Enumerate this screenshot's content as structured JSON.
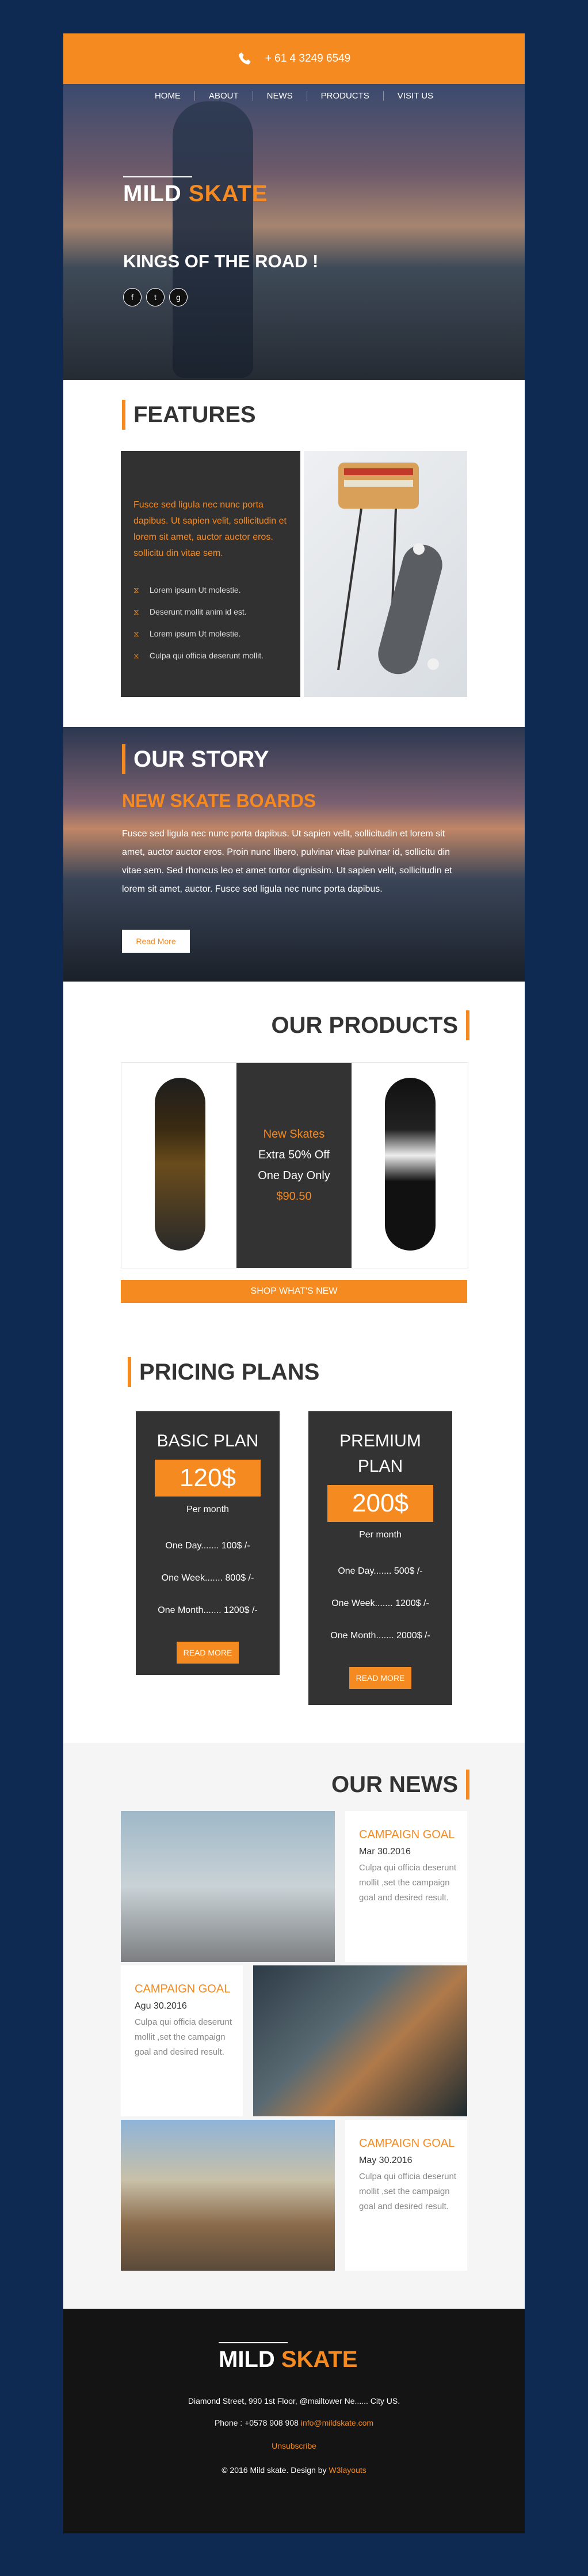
{
  "topbar": {
    "phone": "+ 61 4 3249 6549",
    "phone_icon": "phone-icon"
  },
  "nav": [
    "HOME",
    "ABOUT",
    "NEWS",
    "PRODUCTS",
    "VISIT US"
  ],
  "hero": {
    "logo_mild": "MILD",
    "logo_skate": "SKATE",
    "tagline": "KINGS OF THE ROAD !",
    "social": [
      "f",
      "t",
      "g"
    ]
  },
  "features": {
    "title": "FEATURES",
    "text": "Fusce sed ligula nec nunc porta dapibus. Ut sapien velit, sollicitudin et lorem sit amet, auctor auctor eros. sollicitu din vitae sem.",
    "items": [
      "Lorem ipsum Ut molestie.",
      "Deserunt mollit anim id est.",
      "Lorem ipsum Ut molestie.",
      "Culpa qui officia deserunt mollit."
    ]
  },
  "story": {
    "title": "OUR STORY",
    "subtitle": "NEW SKATE BOARDS",
    "text": "Fusce sed ligula nec nunc porta dapibus. Ut sapien velit, sollicitudin et lorem sit amet, auctor auctor eros. Proin nunc libero, pulvinar vitae pulvinar id, sollicitu din vitae sem. Sed rhoncus leo et amet tortor dignissim. Ut sapien velit, sollicitudin et lorem sit amet, auctor. Fusce sed ligula nec nunc porta dapibus.",
    "button": "Read More"
  },
  "products": {
    "title": "OUR PRODUCTS",
    "promo": [
      "New Skates",
      "Extra 50% Off",
      "One Day Only",
      "$90.50"
    ],
    "button": "SHOP WHAT'S NEW"
  },
  "pricing": {
    "title": "PRICING PLANS",
    "plans": [
      {
        "name": "BASIC PLAN",
        "price": "120$",
        "per": "Per month",
        "rows": [
          "One Day....... 100$ /-",
          "One Week....... 800$ /-",
          "One Month....... 1200$ /-"
        ],
        "button": "READ MORE"
      },
      {
        "name": "PREMIUM PLAN",
        "price": "200$",
        "per": "Per month",
        "rows": [
          "One Day....... 500$ /-",
          "One Week....... 1200$ /-",
          "One Month....... 2000$ /-"
        ],
        "button": "READ MORE"
      }
    ]
  },
  "news": {
    "title": "OUR NEWS",
    "items": [
      {
        "title": "CAMPAIGN GOAL",
        "date": "Mar 30.2016",
        "desc": "Culpa qui officia deserunt mollit ,set the campaign goal and desired result."
      },
      {
        "title": "CAMPAIGN GOAL",
        "date": "Agu 30.2016",
        "desc": "Culpa qui officia deserunt mollit ,set the campaign goal and desired result."
      },
      {
        "title": "CAMPAIGN GOAL",
        "date": "May 30.2016",
        "desc": "Culpa qui officia deserunt mollit ,set the campaign goal and desired result."
      }
    ]
  },
  "footer": {
    "logo_mild": "MILD",
    "logo_skate": "SKATE",
    "address": "Diamond Street, 990 1st Floor, @mailtower Ne...... City US.",
    "phone_label": "Phone : +0578 908 908",
    "email": "info@mildskate.com",
    "unsubscribe": "Unsubscribe",
    "copyright": "© 2016 Mild skate. Design by",
    "designer": "W3layouts"
  },
  "colors": {
    "accent": "#f58a21",
    "dark": "#333333",
    "page_bg": "#0e2a52"
  }
}
